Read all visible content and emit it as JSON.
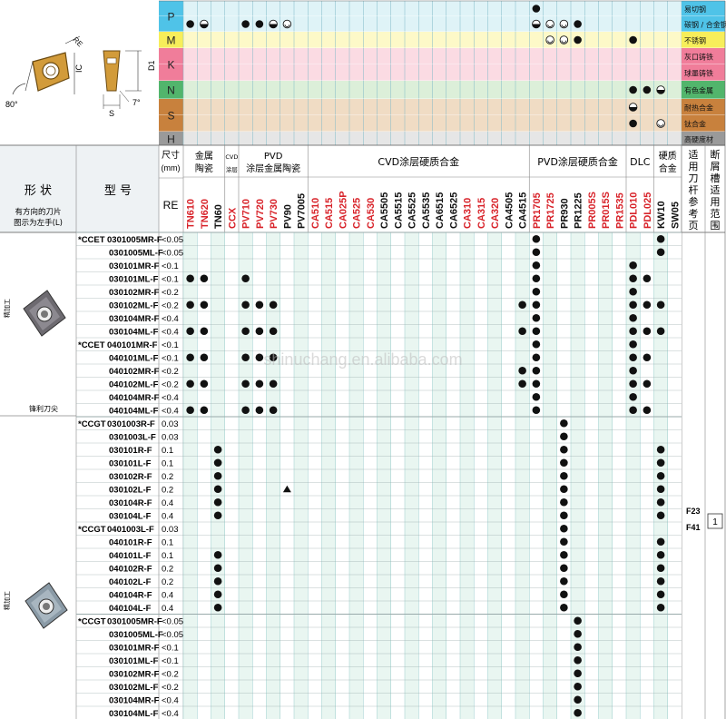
{
  "colors": {
    "p_row": "#4fc3e8",
    "m_row": "#f7ee5a",
    "k_row": "#f07d9a",
    "n_row": "#52b56c",
    "s_row": "#c8813d",
    "h_row": "#9a9a9a",
    "grid_cyan": "#dff3f7",
    "grid_yellow": "#fdf9c8",
    "grid_pink": "#fbdbe3",
    "grid_green": "#dcefd9",
    "grid_brown": "#f0dcc4",
    "grid_grey": "#e6e6e6",
    "red_grade": "#d8232a",
    "col_light": "#e9f6f1"
  },
  "icon_names": [
    "insert-diagram-icon",
    "insert-photo-icon",
    "filled-dot-icon",
    "half-dot-icon",
    "smile-icon",
    "triangle-icon"
  ],
  "diagram": {
    "labels": {
      "re": "RE",
      "ic": "IC",
      "d1": "D1",
      "s": "S",
      "angle": "80°",
      "clearance": "7°"
    }
  },
  "materials": [
    {
      "letter": "P",
      "labels": [
        "易切钢",
        "碳钢 / 合金钢"
      ]
    },
    {
      "letter": "M",
      "labels": [
        "不锈钢"
      ]
    },
    {
      "letter": "K",
      "labels": [
        "灰口铸铁",
        "球墨铸铁"
      ]
    },
    {
      "letter": "N",
      "labels": [
        "有色金属"
      ]
    },
    {
      "letter": "S",
      "labels": [
        "耐热合金",
        "钛合金"
      ]
    },
    {
      "letter": "H",
      "labels": [
        "高硬度材"
      ]
    }
  ],
  "header": {
    "shape": "形  状",
    "direction_note_1": "有方向的刀片",
    "direction_note_2": "图示为左手(L)",
    "model": "型  号",
    "size": "尺寸",
    "size_unit": "(mm)",
    "re": "RE",
    "groups": [
      "金属陶瓷",
      "CVD 涂层金属陶瓷",
      "PVD 涂层金属陶瓷",
      "CVD涂层硬质合金",
      "PVD涂层硬质合金",
      "DLC",
      "硬质合金"
    ],
    "cvd_cermet_short": "CVD 涂层",
    "pvd_cermet_1": "PVD",
    "pvd_cermet_2": "涂层金属陶瓷",
    "metal_ceramic_1": "金属",
    "metal_ceramic_2": "陶瓷",
    "carbide_1": "硬质",
    "carbide_2": "合金",
    "holder_ref": "适用刀杆参考页",
    "chipbreaker": "断屑槽适用范围"
  },
  "grades": [
    {
      "name": "TN610",
      "color": "red"
    },
    {
      "name": "TN620",
      "color": "red"
    },
    {
      "name": "TN60",
      "color": "black"
    },
    {
      "name": "CCX",
      "color": "red"
    },
    {
      "name": "PV710",
      "color": "red"
    },
    {
      "name": "PV720",
      "color": "red"
    },
    {
      "name": "PV730",
      "color": "red"
    },
    {
      "name": "PV90",
      "color": "black"
    },
    {
      "name": "PV7005",
      "color": "black"
    },
    {
      "name": "CA510",
      "color": "red"
    },
    {
      "name": "CA515",
      "color": "red"
    },
    {
      "name": "CA025P",
      "color": "red"
    },
    {
      "name": "CA525",
      "color": "red"
    },
    {
      "name": "CA530",
      "color": "red"
    },
    {
      "name": "CA5505",
      "color": "black"
    },
    {
      "name": "CA5515",
      "color": "black"
    },
    {
      "name": "CA5525",
      "color": "black"
    },
    {
      "name": "CA5535",
      "color": "black"
    },
    {
      "name": "CA6515",
      "color": "black"
    },
    {
      "name": "CA6525",
      "color": "black"
    },
    {
      "name": "CA310",
      "color": "red"
    },
    {
      "name": "CA315",
      "color": "red"
    },
    {
      "name": "CA320",
      "color": "red"
    },
    {
      "name": "CA4505",
      "color": "black"
    },
    {
      "name": "CA4515",
      "color": "black"
    },
    {
      "name": "PR1705",
      "color": "red"
    },
    {
      "name": "PR1725",
      "color": "red"
    },
    {
      "name": "PR930",
      "color": "black"
    },
    {
      "name": "PR1225",
      "color": "black"
    },
    {
      "name": "PR005S",
      "color": "red"
    },
    {
      "name": "PR015S",
      "color": "red"
    },
    {
      "name": "PR1535",
      "color": "red"
    },
    {
      "name": "PDL010",
      "color": "red"
    },
    {
      "name": "PDL025",
      "color": "red"
    },
    {
      "name": "KW10",
      "color": "black"
    },
    {
      "name": "SW05",
      "color": "black"
    }
  ],
  "sections": [
    {
      "label": "精加工",
      "sub": "锋利刀尖"
    },
    {
      "label": "精加工",
      "sub": ""
    }
  ],
  "rows": [
    {
      "star": "*CCET",
      "model": "0301005MR-F",
      "re": "<0.05"
    },
    {
      "star": "",
      "model": "0301005ML-F",
      "re": "<0.05"
    },
    {
      "star": "",
      "model": "030101MR-F",
      "re": "<0.1"
    },
    {
      "star": "",
      "model": "030101ML-F",
      "re": "<0.1"
    },
    {
      "star": "",
      "model": "030102MR-F",
      "re": "<0.2"
    },
    {
      "star": "",
      "model": "030102ML-F",
      "re": "<0.2"
    },
    {
      "star": "",
      "model": "030104MR-F",
      "re": "<0.4"
    },
    {
      "star": "",
      "model": "030104ML-F",
      "re": "<0.4"
    },
    {
      "star": "*CCET",
      "model": "040101MR-F",
      "re": "<0.1"
    },
    {
      "star": "",
      "model": "040101ML-F",
      "re": "<0.1"
    },
    {
      "star": "",
      "model": "040102MR-F",
      "re": "<0.2"
    },
    {
      "star": "",
      "model": "040102ML-F",
      "re": "<0.2"
    },
    {
      "star": "",
      "model": "040104MR-F",
      "re": "<0.4"
    },
    {
      "star": "",
      "model": "040104ML-F",
      "re": "<0.4"
    },
    {
      "star": "*CCGT",
      "model": "0301003R-F",
      "re": "0.03"
    },
    {
      "star": "",
      "model": "0301003L-F",
      "re": "0.03"
    },
    {
      "star": "",
      "model": "030101R-F",
      "re": "0.1"
    },
    {
      "star": "",
      "model": "030101L-F",
      "re": "0.1"
    },
    {
      "star": "",
      "model": "030102R-F",
      "re": "0.2"
    },
    {
      "star": "",
      "model": "030102L-F",
      "re": "0.2"
    },
    {
      "star": "",
      "model": "030104R-F",
      "re": "0.4"
    },
    {
      "star": "",
      "model": "030104L-F",
      "re": "0.4"
    },
    {
      "star": "*CCGT",
      "model": "0401003L-F",
      "re": "0.03"
    },
    {
      "star": "",
      "model": "040101R-F",
      "re": "0.1"
    },
    {
      "star": "",
      "model": "040101L-F",
      "re": "0.1"
    },
    {
      "star": "",
      "model": "040102R-F",
      "re": "0.2"
    },
    {
      "star": "",
      "model": "040102L-F",
      "re": "0.2"
    },
    {
      "star": "",
      "model": "040104R-F",
      "re": "0.4"
    },
    {
      "star": "",
      "model": "040104L-F",
      "re": "0.4"
    },
    {
      "star": "*CCGT",
      "model": "0301005MR-F",
      "re": "<0.05"
    },
    {
      "star": "",
      "model": "0301005ML-F",
      "re": "<0.05"
    },
    {
      "star": "",
      "model": "030101MR-F",
      "re": "<0.1"
    },
    {
      "star": "",
      "model": "030101ML-F",
      "re": "<0.1"
    },
    {
      "star": "",
      "model": "030102MR-F",
      "re": "<0.2"
    },
    {
      "star": "",
      "model": "030102ML-F",
      "re": "<0.2"
    },
    {
      "star": "",
      "model": "030104MR-F",
      "re": "<0.4"
    },
    {
      "star": "",
      "model": "030104ML-F",
      "re": "<0.4"
    }
  ],
  "dots": [
    [
      0,
      25
    ],
    [
      0,
      34
    ],
    [
      1,
      25
    ],
    [
      1,
      34
    ],
    [
      2,
      25
    ],
    [
      2,
      32
    ],
    [
      3,
      0
    ],
    [
      3,
      1
    ],
    [
      3,
      4
    ],
    [
      3,
      25
    ],
    [
      3,
      32
    ],
    [
      3,
      33
    ],
    [
      4,
      25
    ],
    [
      4,
      32
    ],
    [
      5,
      0
    ],
    [
      5,
      1
    ],
    [
      5,
      4
    ],
    [
      5,
      5
    ],
    [
      5,
      6
    ],
    [
      5,
      24
    ],
    [
      5,
      25
    ],
    [
      5,
      32
    ],
    [
      5,
      33
    ],
    [
      5,
      34
    ],
    [
      6,
      25
    ],
    [
      6,
      32
    ],
    [
      7,
      0
    ],
    [
      7,
      1
    ],
    [
      7,
      4
    ],
    [
      7,
      5
    ],
    [
      7,
      6
    ],
    [
      7,
      24
    ],
    [
      7,
      25
    ],
    [
      7,
      32
    ],
    [
      7,
      33
    ],
    [
      7,
      34
    ],
    [
      8,
      25
    ],
    [
      8,
      32
    ],
    [
      9,
      0
    ],
    [
      9,
      1
    ],
    [
      9,
      4
    ],
    [
      9,
      5
    ],
    [
      9,
      6
    ],
    [
      9,
      25
    ],
    [
      9,
      32
    ],
    [
      9,
      33
    ],
    [
      10,
      24
    ],
    [
      10,
      25
    ],
    [
      10,
      32
    ],
    [
      11,
      0
    ],
    [
      11,
      1
    ],
    [
      11,
      4
    ],
    [
      11,
      5
    ],
    [
      11,
      6
    ],
    [
      11,
      24
    ],
    [
      11,
      25
    ],
    [
      11,
      32
    ],
    [
      11,
      33
    ],
    [
      12,
      25
    ],
    [
      12,
      32
    ],
    [
      13,
      0
    ],
    [
      13,
      1
    ],
    [
      13,
      4
    ],
    [
      13,
      5
    ],
    [
      13,
      6
    ],
    [
      13,
      25
    ],
    [
      13,
      32
    ],
    [
      13,
      33
    ],
    [
      14,
      27
    ],
    [
      15,
      27
    ],
    [
      16,
      2
    ],
    [
      16,
      27
    ],
    [
      16,
      34
    ],
    [
      17,
      2
    ],
    [
      17,
      27
    ],
    [
      17,
      34
    ],
    [
      18,
      2
    ],
    [
      18,
      27
    ],
    [
      18,
      34
    ],
    [
      19,
      2
    ],
    [
      19,
      27
    ],
    [
      19,
      34
    ],
    [
      20,
      2
    ],
    [
      20,
      27
    ],
    [
      20,
      34
    ],
    [
      21,
      2
    ],
    [
      21,
      27
    ],
    [
      21,
      34
    ],
    [
      22,
      27
    ],
    [
      23,
      27
    ],
    [
      23,
      34
    ],
    [
      24,
      2
    ],
    [
      24,
      27
    ],
    [
      24,
      34
    ],
    [
      25,
      2
    ],
    [
      25,
      27
    ],
    [
      25,
      34
    ],
    [
      26,
      2
    ],
    [
      26,
      27
    ],
    [
      26,
      34
    ],
    [
      27,
      2
    ],
    [
      27,
      27
    ],
    [
      27,
      34
    ],
    [
      28,
      2
    ],
    [
      28,
      27
    ],
    [
      28,
      34
    ],
    [
      29,
      28
    ],
    [
      30,
      28
    ],
    [
      31,
      28
    ],
    [
      32,
      28
    ],
    [
      33,
      28
    ],
    [
      34,
      28
    ],
    [
      35,
      28
    ],
    [
      36,
      28
    ]
  ],
  "triangles": [
    [
      19,
      7
    ]
  ],
  "material_marks": [
    {
      "row": 0,
      "col": 25,
      "kind": "dot"
    },
    {
      "row": 0,
      "col": 26,
      "kind": "none"
    },
    {
      "row": 1,
      "col": 0,
      "kind": "dot"
    },
    {
      "row": 1,
      "col": 1,
      "kind": "half"
    },
    {
      "row": 1,
      "col": 4,
      "kind": "dot"
    },
    {
      "row": 1,
      "col": 5,
      "kind": "dot"
    },
    {
      "row": 1,
      "col": 6,
      "kind": "half"
    },
    {
      "row": 1,
      "col": 7,
      "kind": "smile"
    },
    {
      "row": 1,
      "col": 25,
      "kind": "half"
    },
    {
      "row": 1,
      "col": 26,
      "kind": "smile"
    },
    {
      "row": 1,
      "col": 27,
      "kind": "smile"
    },
    {
      "row": 1,
      "col": 28,
      "kind": "dot"
    },
    {
      "row": 2,
      "col": 26,
      "kind": "smile"
    },
    {
      "row": 2,
      "col": 27,
      "kind": "smile"
    },
    {
      "row": 2,
      "col": 28,
      "kind": "dot"
    },
    {
      "row": 2,
      "col": 32,
      "kind": "dot"
    },
    {
      "row": 5,
      "col": 32,
      "kind": "dot"
    },
    {
      "row": 5,
      "col": 33,
      "kind": "dot"
    },
    {
      "row": 5,
      "col": 34,
      "kind": "half"
    },
    {
      "row": 6,
      "col": 32,
      "kind": "half"
    },
    {
      "row": 7,
      "col": 32,
      "kind": "dot"
    },
    {
      "row": 7,
      "col": 34,
      "kind": "smile"
    }
  ],
  "side_refs": {
    "f23": "F23",
    "f41": "F41",
    "page_box": "1"
  },
  "watermark": "shinuchang.en.alibaba.com"
}
